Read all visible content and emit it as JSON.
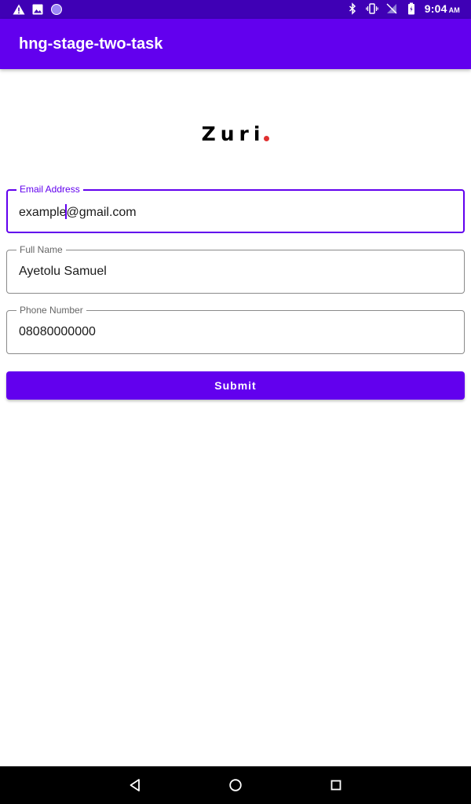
{
  "status_bar": {
    "time": "9:04",
    "ampm": "AM",
    "left_icons": [
      "warning-icon",
      "image-icon",
      "circle-notification-icon"
    ],
    "right_icons": [
      "bluetooth-icon",
      "vibrate-icon",
      "no-signal-icon",
      "battery-icon"
    ]
  },
  "app_bar": {
    "title": "hng-stage-two-task"
  },
  "logo": {
    "text": "Zuri",
    "dot_color": "#e03131"
  },
  "form": {
    "email": {
      "label": "Email Address",
      "value_before_caret": "example",
      "value_after_caret": "@gmail.com"
    },
    "full_name": {
      "label": "Full Name",
      "value": "Ayetolu Samuel"
    },
    "phone": {
      "label": "Phone Number",
      "value": "08080000000"
    },
    "submit_label": "Submit"
  },
  "nav_bar": {
    "buttons": [
      "back-icon",
      "home-icon",
      "recents-icon"
    ]
  },
  "colors": {
    "primary": "#6200ee",
    "status_bar": "#3f00b5",
    "accent_dot": "#e03131"
  }
}
